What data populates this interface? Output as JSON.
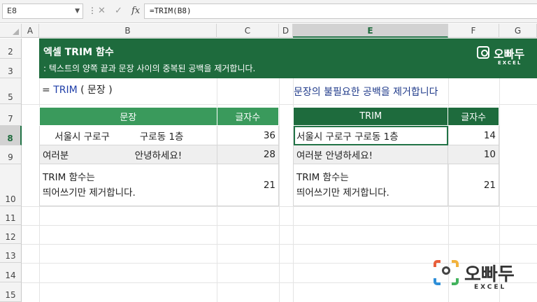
{
  "formula_bar": {
    "name_box": "E8",
    "formula": "=TRIM(B8)",
    "fx_label": "fx"
  },
  "columns": [
    "A",
    "B",
    "C",
    "D",
    "E",
    "F",
    "G"
  ],
  "rows": [
    "2",
    "3",
    "5",
    "7",
    "8",
    "9",
    "10",
    "11",
    "12",
    "13",
    "14",
    "15"
  ],
  "banner": {
    "title": "엑셀 TRIM 함수",
    "subtitle": ":  텍스트의 양쪽 끝과 문장 사이의 중복된 공백을 제거합니다.",
    "logo_name": "오빠두",
    "logo_sub": "EXCEL"
  },
  "syntax": {
    "prefix": "= ",
    "fn": "TRIM",
    "args": " ( 문장 )"
  },
  "description": "문장의 불필요한 공백을 제거합니다",
  "left_table": {
    "headers": [
      "문장",
      "글자수"
    ],
    "rows": [
      {
        "text": "    서울시 구로구          구로동 1층",
        "count": "36"
      },
      {
        "text": "여러분                      안녕하세요!",
        "count": "28"
      },
      {
        "text_line1": "TRIM 함수는",
        "text_line2": "띄어쓰기만 제거합니다.",
        "count": "21"
      }
    ]
  },
  "right_table": {
    "headers": [
      "TRIM",
      "글자수"
    ],
    "rows": [
      {
        "text": "서울시 구로구 구로동 1층",
        "count": "14"
      },
      {
        "text": "여러분 안녕하세요!",
        "count": "10"
      },
      {
        "text_line1": "TRIM 함수는",
        "text_line2": "띄어쓰기만 제거합니다.",
        "count": "21"
      }
    ]
  },
  "bottom_logo": {
    "name": "오빠두",
    "sub": "EXCEL"
  }
}
